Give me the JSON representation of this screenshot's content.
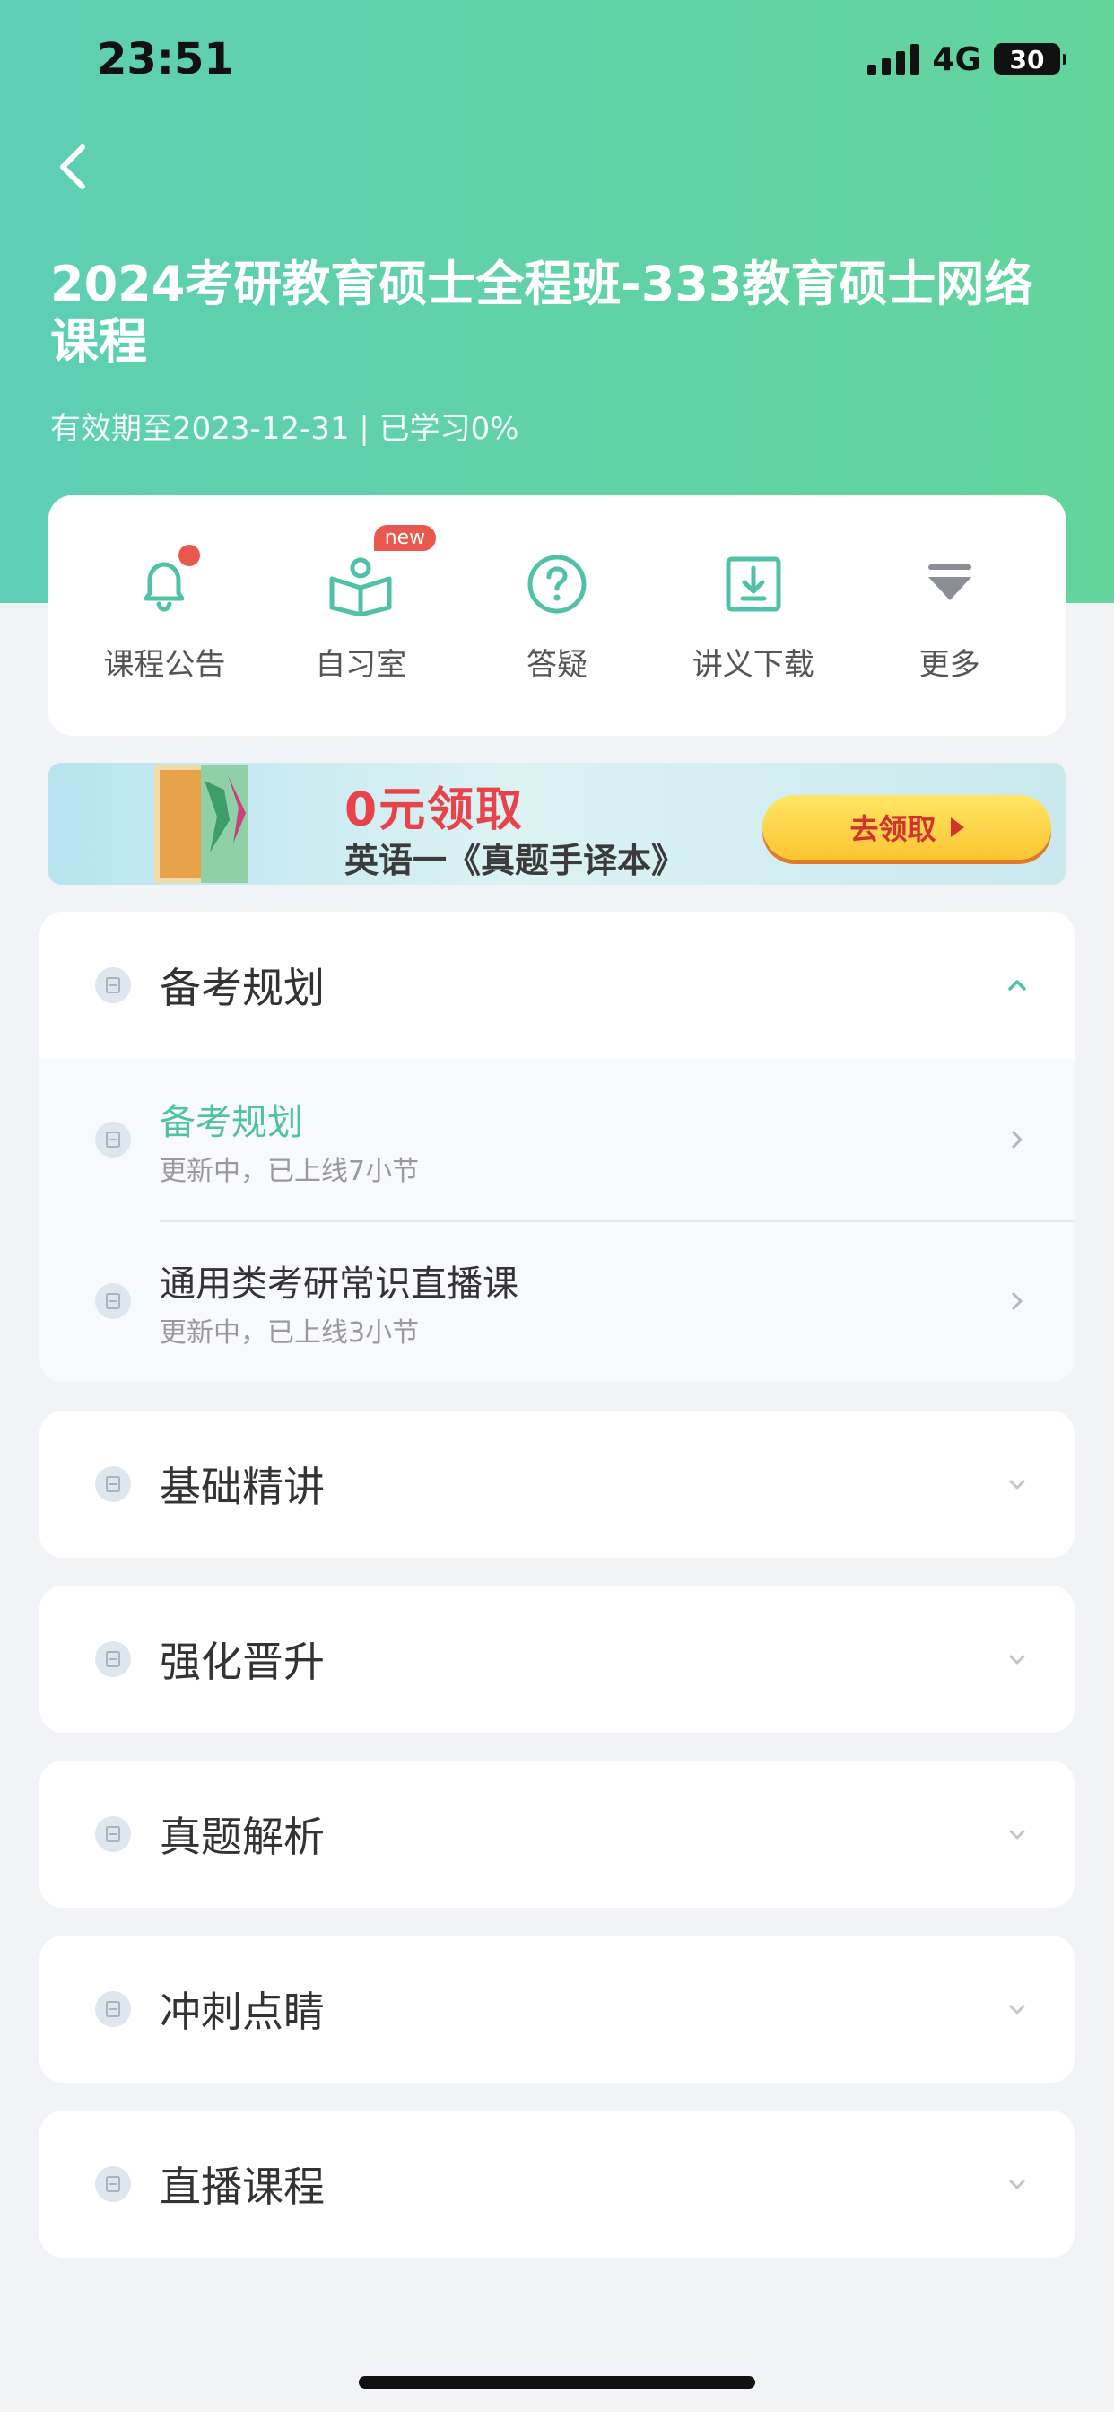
{
  "status_bar": {
    "time": "23:51",
    "network": "4G",
    "battery": "30"
  },
  "header": {
    "title": "2024考研教育硕士全程班-333教育硕士网络课程",
    "subtitle": "有效期至2023-12-31 | 已学习0%"
  },
  "tools": [
    {
      "label": "课程公告",
      "icon": "bell-icon"
    },
    {
      "label": "自习室",
      "icon": "open-book-icon",
      "badge": "new"
    },
    {
      "label": "答疑",
      "icon": "question-icon"
    },
    {
      "label": "讲义下载",
      "icon": "download-icon"
    },
    {
      "label": "更多",
      "icon": "more-icon"
    }
  ],
  "banner": {
    "headline": "0元领取",
    "subline": "英语一《真题手译本》",
    "button": "去领取"
  },
  "sections": [
    {
      "title": "备考规划",
      "expanded": true,
      "items": [
        {
          "title": "备考规划",
          "meta": "更新中，已上线7小节",
          "active": true
        },
        {
          "title": "通用类考研常识直播课",
          "meta": "更新中，已上线3小节",
          "active": false
        }
      ]
    },
    {
      "title": "基础精讲",
      "expanded": false
    },
    {
      "title": "强化晋升",
      "expanded": false
    },
    {
      "title": "真题解析",
      "expanded": false
    },
    {
      "title": "冲刺点睛",
      "expanded": false
    },
    {
      "title": "直播课程",
      "expanded": false
    }
  ],
  "colors": {
    "accent": "#4fc1a6",
    "header_start": "#5ecfb3",
    "header_end": "#63d49c",
    "badge": "#e8584c"
  }
}
